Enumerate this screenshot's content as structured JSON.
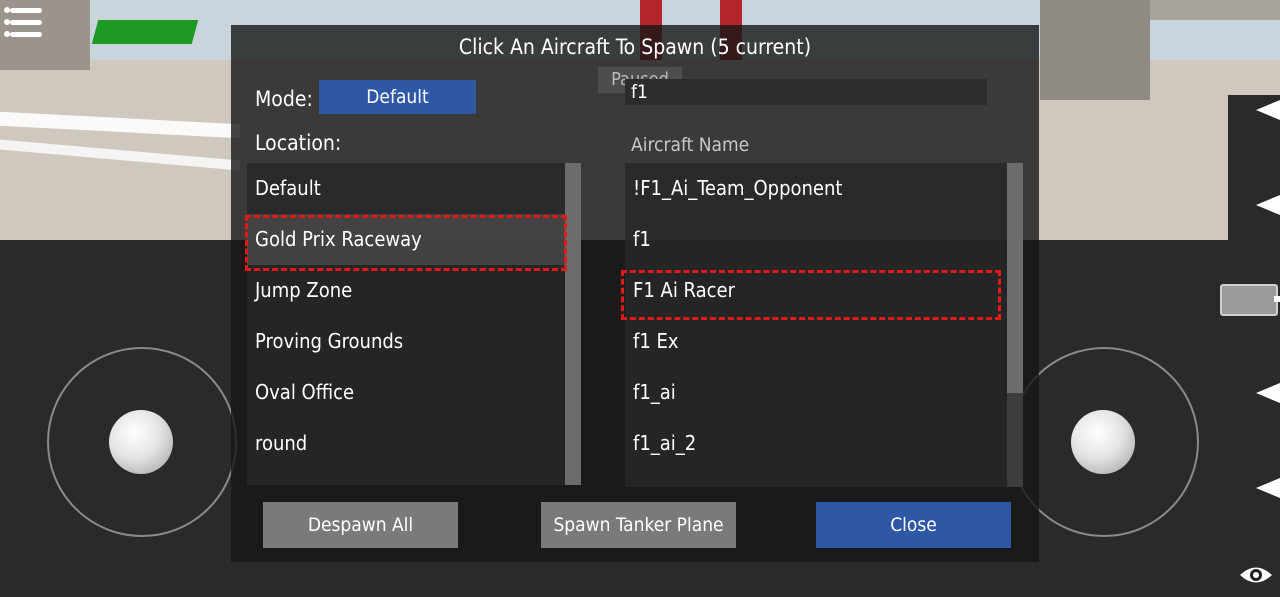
{
  "dialog": {
    "title": "Click An Aircraft To Spawn (5 current)",
    "paused_label": "Paused",
    "mode_label": "Mode:",
    "mode_value": "Default",
    "location_label": "Location:",
    "search_value": "f1",
    "name_placeholder": "Aircraft Name"
  },
  "locations": [
    {
      "label": "Default"
    },
    {
      "label": "Gold Prix Raceway"
    },
    {
      "label": "Jump Zone"
    },
    {
      "label": "Proving Grounds"
    },
    {
      "label": "Oval Office"
    },
    {
      "label": "round"
    }
  ],
  "aircraft": [
    {
      "label": "!F1_Ai_Team_Opponent"
    },
    {
      "label": "f1"
    },
    {
      "label": "F1 Ai Racer"
    },
    {
      "label": "f1 Ex"
    },
    {
      "label": "f1_ai"
    },
    {
      "label": "f1_ai_2"
    }
  ],
  "buttons": {
    "despawn_all": "Despawn All",
    "spawn_tanker": "Spawn Tanker Plane",
    "close": "Close"
  },
  "colors": {
    "accent_blue": "#2e57a6",
    "highlight_red": "#e0191b",
    "button_gray": "#7a7a7a"
  },
  "icons": [
    "menu-icon",
    "eye-icon",
    "arrow-left-icon"
  ]
}
